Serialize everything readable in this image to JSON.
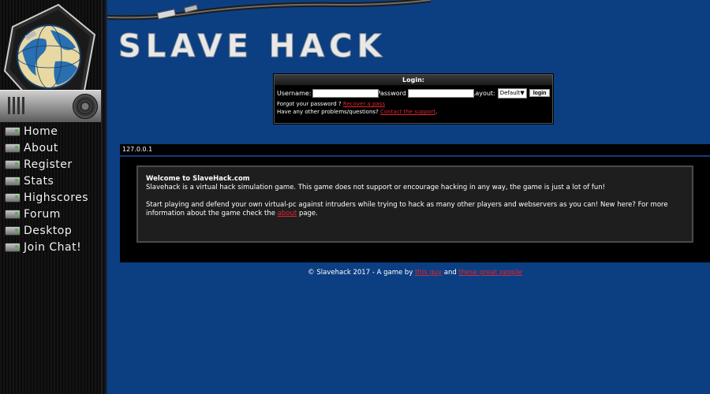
{
  "logo": {
    "text": "SLAVE HACK"
  },
  "nav": [
    {
      "label": "Home",
      "icon": "computer-icon"
    },
    {
      "label": "About",
      "icon": "computer-icon"
    },
    {
      "label": "Register",
      "icon": "computer-icon"
    },
    {
      "label": "Stats",
      "icon": "computer-icon"
    },
    {
      "label": "Highscores",
      "icon": "computer-icon"
    },
    {
      "label": "Forum",
      "icon": "computer-icon"
    },
    {
      "label": "Desktop",
      "icon": "computer-icon"
    },
    {
      "label": "Join Chat!",
      "icon": "computer-icon"
    }
  ],
  "login": {
    "title": "Login:",
    "username_label": "Username:",
    "username_value": "",
    "password_label": "Password",
    "password_value": "",
    "layout_label": "Layout:",
    "layout_selected": "Default",
    "login_button": "login",
    "forgot_prefix": "Forgot your password ?",
    "forgot_link": "Recover a pass",
    "problems_prefix": "Have any other problems/questions?",
    "problems_link": "Contact the support",
    "problems_suffix": "."
  },
  "ip": "127.0.0.1",
  "content": {
    "title": "Welcome to SlaveHack.com",
    "intro": "Slavehack is a virtual hack simulation game. This game does not support or encourage hacking in any way, the game is just a lot of fun!",
    "body_before": "Start playing and defend your own virtual-pc against intruders while trying to hack as many other players and webservers as you can! New here? For more information about the game check the",
    "body_link": "about",
    "body_after": "page."
  },
  "footer": {
    "prefix": "© Slavehack 2017 - A game by",
    "link1": "this guy",
    "middle": "and",
    "link2": "these great people"
  },
  "colors": {
    "background": "#0c3f82",
    "link_red": "#e1262f",
    "panel": "#000000"
  }
}
